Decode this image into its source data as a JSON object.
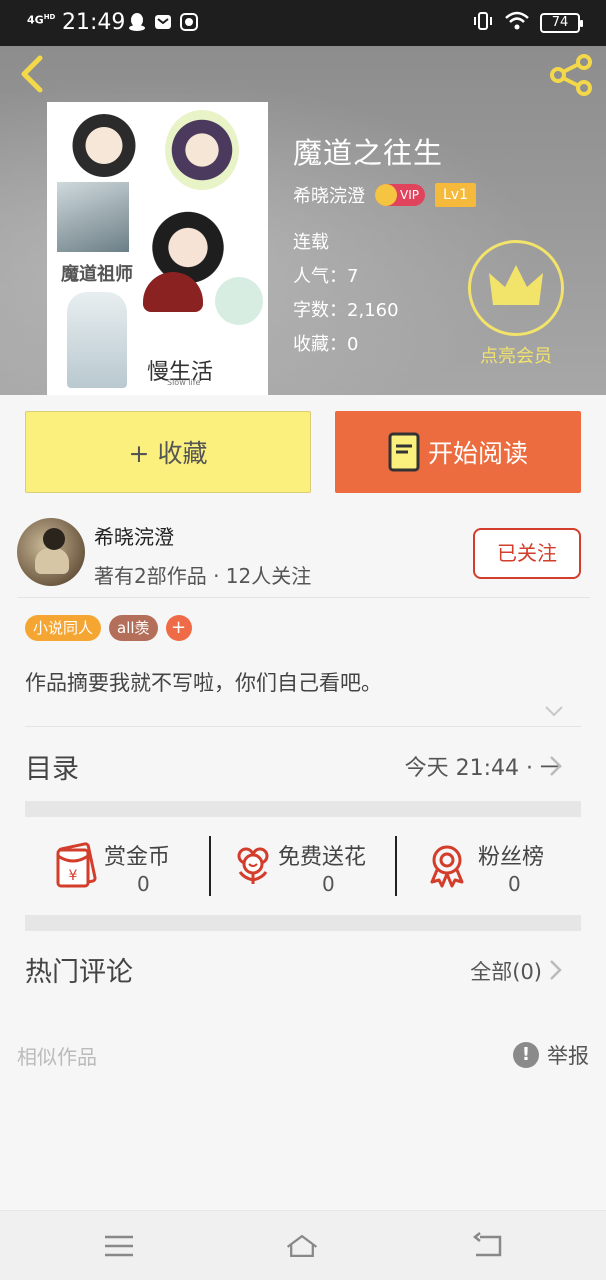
{
  "status_bar": {
    "network": "4G",
    "network_sub": "HD",
    "time": "21:49",
    "battery": "74"
  },
  "book": {
    "title": "魔道之往生",
    "author": "希晓浣澄",
    "vip_label": "VIP",
    "level": "Lv1",
    "status": "连载",
    "popularity": "人气：7",
    "word_count": "字数：2,160",
    "favorites": "收藏：0",
    "cover": {
      "title": "慢生活",
      "subtitle": "Slow life",
      "vertical_text": "魔道祖师"
    }
  },
  "member": {
    "label": "点亮会员"
  },
  "actions": {
    "collect_label": "+ 收藏",
    "read_label": "开始阅读"
  },
  "author_card": {
    "name": "希晓浣澄",
    "stats": "著有2部作品 · 12人关注",
    "follow_label": "已关注"
  },
  "tags": [
    "小说同人",
    "all羡",
    "+"
  ],
  "summary": "作品摘要我就不写啦，你们自己看吧。",
  "toc": {
    "label": "目录",
    "info": "今天 21:44 · 一"
  },
  "rewards": [
    {
      "label": "赏金币",
      "value": "0",
      "icon": "red-envelope-yen-icon"
    },
    {
      "label": "免费送花",
      "value": "0",
      "icon": "flower-icon"
    },
    {
      "label": "粉丝榜",
      "value": "0",
      "icon": "medal-icon"
    }
  ],
  "comments": {
    "label": "热门评论",
    "all_label": "全部(0)"
  },
  "similar_label": "相似作品",
  "report_label": "举报",
  "colors": {
    "accent_orange": "#ec6c3f",
    "collect_yellow": "#fbf07e",
    "follow_red": "#d33d2b",
    "member_gold": "#f2e36b"
  }
}
